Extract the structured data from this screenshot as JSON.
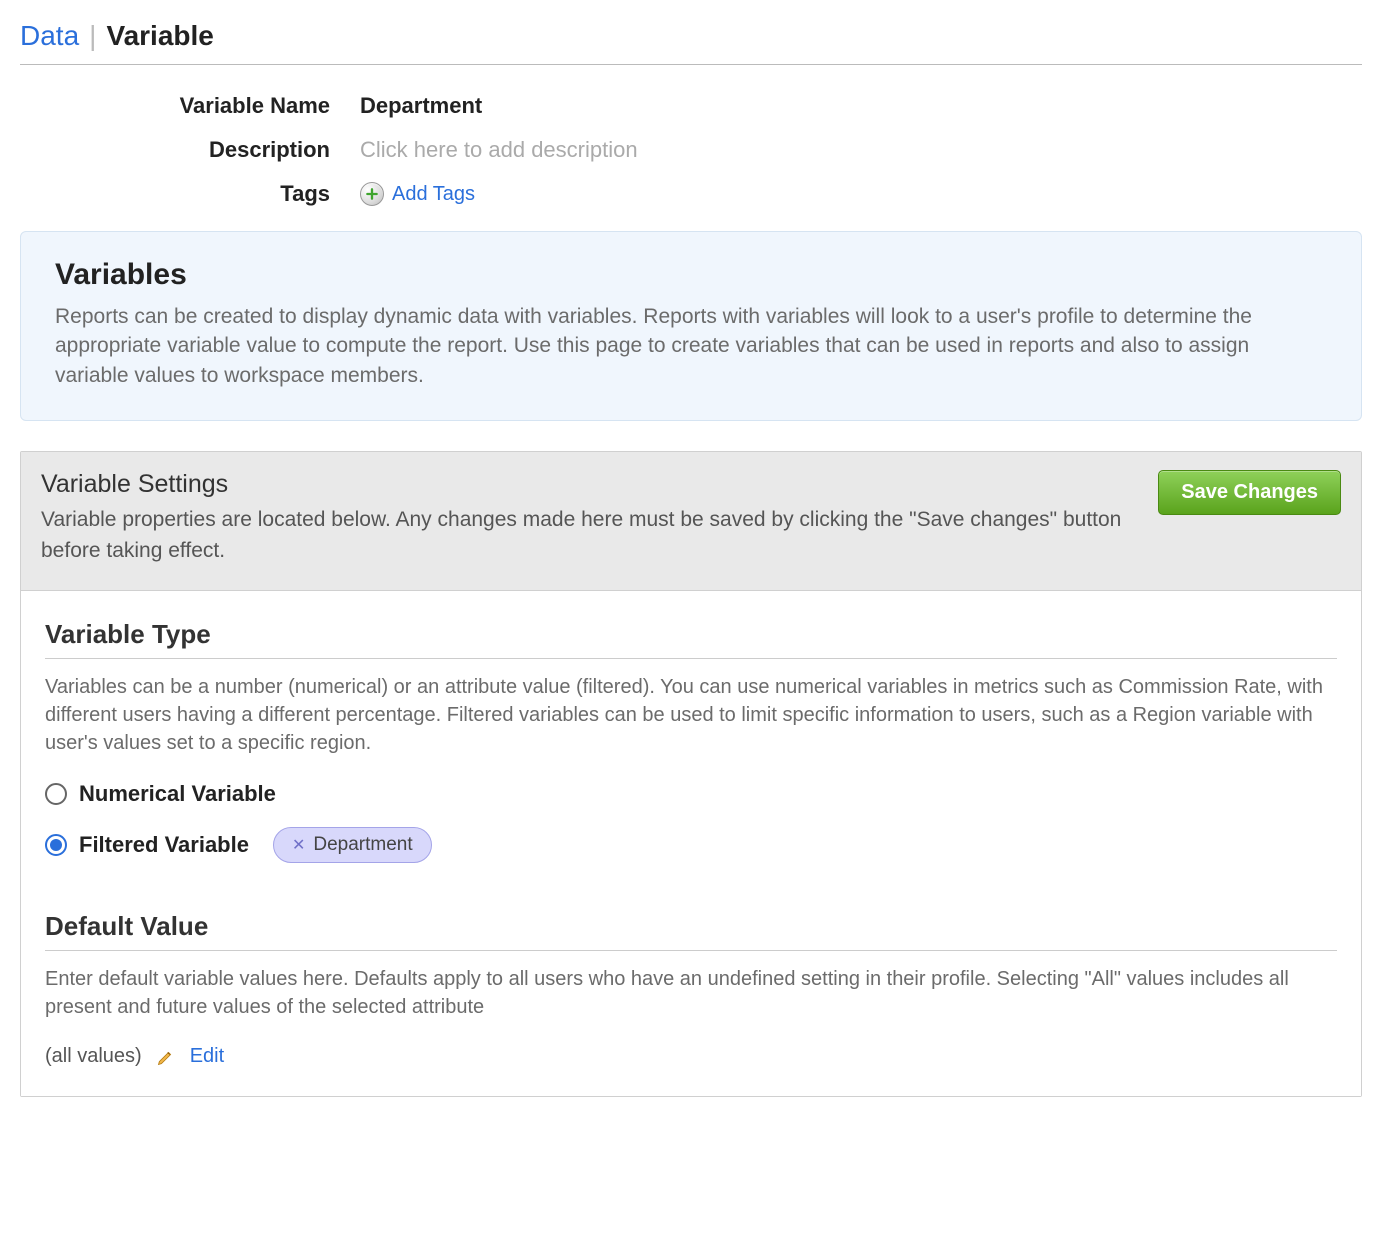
{
  "breadcrumb": {
    "root": "Data",
    "current": "Variable"
  },
  "meta": {
    "name_label": "Variable Name",
    "name_value": "Department",
    "desc_label": "Description",
    "desc_placeholder": "Click here to add description",
    "tags_label": "Tags",
    "add_tags": "Add Tags"
  },
  "info": {
    "title": "Variables",
    "text": "Reports can be created to display dynamic data with variables. Reports with variables will look to a user's profile to determine the appropriate variable value to compute the report. Use this page to create variables that can be used in reports and also to assign variable values to workspace members."
  },
  "settings": {
    "title": "Variable Settings",
    "subtitle": "Variable properties are located below. Any changes made here must be saved by clicking the \"Save changes\" button before taking effect.",
    "save": "Save Changes"
  },
  "type": {
    "title": "Variable Type",
    "help": "Variables can be a number (numerical) or an attribute value (filtered). You can use numerical variables in metrics such as Commission Rate, with different users having a different percentage. Filtered variables can be used to limit specific information to users, such as a Region variable with user's values set to a specific region.",
    "numerical_label": "Numerical Variable",
    "filtered_label": "Filtered Variable",
    "selected": "filtered",
    "filter_pill": "Department"
  },
  "default": {
    "title": "Default Value",
    "help": "Enter default variable values here. Defaults apply to all users who have an undefined setting in their profile. Selecting \"All\" values includes all present and future values of the selected attribute",
    "current": "(all values)",
    "edit": "Edit"
  }
}
